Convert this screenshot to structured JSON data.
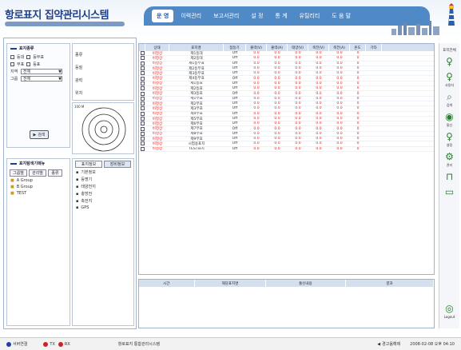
{
  "app": {
    "title": "항로표지 집약관리시스템"
  },
  "nav": {
    "tabs": [
      {
        "label": "운 영",
        "active": true
      },
      {
        "label": "이력관리",
        "active": false
      },
      {
        "label": "보고서관리",
        "active": false
      },
      {
        "label": "설 정",
        "active": false
      },
      {
        "label": "통 계",
        "active": false
      },
      {
        "label": "유틸리티",
        "active": false
      },
      {
        "label": "도 움 말",
        "active": false
      }
    ]
  },
  "left": {
    "search_header": "표지종류",
    "filter_opts": [
      "등대",
      "등부표",
      "부표",
      "등표"
    ],
    "region_label": "지역",
    "region_value": "전체",
    "group_label": "그룹",
    "group_value": "전체",
    "search_button": "검색",
    "info_labels": [
      "종류",
      "등질",
      "광력",
      "위치"
    ],
    "radar_scale": "100 M",
    "tree_header": "표지탐색기메뉴",
    "tree_tabs": [
      "그룹별",
      "관리별",
      "종류"
    ],
    "tree_items": [
      "A Group",
      "B Group",
      "TEST"
    ],
    "info_tabs": [
      "표지정보",
      "장비정보"
    ],
    "equipment_items": [
      "기본정보",
      "등명기",
      "태양전지",
      "충방전",
      "축전지",
      "GPS"
    ]
  },
  "table": {
    "columns": [
      "상태",
      "표지명",
      "점등기",
      "출력(V)",
      "출력(A)",
      "태양(V)",
      "축전(V)",
      "축전(A)",
      "온도",
      "기타"
    ],
    "rows": [
      [
        "비정상",
        "제1등대",
        "Off",
        "0.0",
        "0.0",
        "0.0",
        "0.0",
        "0.0",
        "0"
      ],
      [
        "비정상",
        "제2등대",
        "Off",
        "0.0",
        "0.0",
        "0.0",
        "0.0",
        "0.0",
        "0"
      ],
      [
        "비정상",
        "제1등부표",
        "Off",
        "0.0",
        "0.0",
        "0.0",
        "0.0",
        "0.0",
        "0"
      ],
      [
        "비정상",
        "제2등부표",
        "Off",
        "0.0",
        "0.0",
        "0.0",
        "0.0",
        "0.0",
        "0"
      ],
      [
        "비정상",
        "제3등부표",
        "Off",
        "0.0",
        "0.0",
        "0.0",
        "0.0",
        "0.0",
        "0"
      ],
      [
        "비정상",
        "제4등부표",
        "Off",
        "0.0",
        "0.0",
        "0.0",
        "0.0",
        "0.0",
        "0"
      ],
      [
        "비정상",
        "제1등표",
        "Off",
        "0.0",
        "0.0",
        "0.0",
        "0.0",
        "0.0",
        "0"
      ],
      [
        "비정상",
        "제2등표",
        "Off",
        "0.0",
        "0.0",
        "0.0",
        "0.0",
        "0.0",
        "0"
      ],
      [
        "비정상",
        "제3등표",
        "Off",
        "0.0",
        "0.0",
        "0.0",
        "0.0",
        "0.0",
        "0"
      ],
      [
        "비정상",
        "제1부표",
        "Off",
        "0.0",
        "0.0",
        "0.0",
        "0.0",
        "0.0",
        "0"
      ],
      [
        "비정상",
        "제2부표",
        "Off",
        "0.0",
        "0.0",
        "0.0",
        "0.0",
        "0.0",
        "0"
      ],
      [
        "비정상",
        "제3부표",
        "Off",
        "0.0",
        "0.0",
        "0.0",
        "0.0",
        "0.0",
        "0"
      ],
      [
        "비정상",
        "제4부표",
        "Off",
        "0.0",
        "0.0",
        "0.0",
        "0.0",
        "0.0",
        "0"
      ],
      [
        "비정상",
        "제5부표",
        "Off",
        "0.0",
        "0.0",
        "0.0",
        "0.0",
        "0.0",
        "0"
      ],
      [
        "비정상",
        "제6부표",
        "Off",
        "0.0",
        "0.0",
        "0.0",
        "0.0",
        "0.0",
        "0"
      ],
      [
        "비정상",
        "제7부표",
        "Off",
        "0.0",
        "0.0",
        "0.0",
        "0.0",
        "0.0",
        "0"
      ],
      [
        "비정상",
        "제8부표",
        "Off",
        "0.0",
        "0.0",
        "0.0",
        "0.0",
        "0.0",
        "0"
      ],
      [
        "비정상",
        "제9부표",
        "Off",
        "0.0",
        "0.0",
        "0.0",
        "0.0",
        "0.0",
        "0"
      ],
      [
        "비정상",
        "시험용표지",
        "Off",
        "0.0",
        "0.0",
        "0.0",
        "0.0",
        "0.0",
        "0"
      ],
      [
        "비정상",
        "TEST표지",
        "Off",
        "0.0",
        "0.0",
        "0.0",
        "0.0",
        "0.0",
        "0"
      ]
    ]
  },
  "events": {
    "columns": [
      "시간",
      "해당표지명",
      "통신내용",
      "결과"
    ]
  },
  "rightbar": {
    "icons": [
      {
        "name": "light-icon",
        "label": "표지전체"
      },
      {
        "name": "user-icon",
        "label": "사용자"
      },
      {
        "name": "search-user-icon",
        "label": "검색"
      },
      {
        "name": "signal-icon",
        "label": "통신"
      },
      {
        "name": "user-icon-2",
        "label": "설정"
      },
      {
        "name": "settings-icon",
        "label": "관리"
      },
      {
        "name": "lock-icon",
        "label": ""
      },
      {
        "name": "monitor-icon",
        "label": ""
      },
      {
        "name": "exit-icon",
        "label": "Logout"
      }
    ]
  },
  "status": {
    "connection": "서버연결",
    "com": "TX",
    "com2": "RX",
    "center_text": "항로표지 통합관리시스템",
    "alarm": "경고음해제",
    "datetime": "2008-02-08 오후 04:10"
  },
  "colors": {
    "accent": "#4f89c6",
    "alert": "#dd2222",
    "title": "#1d3f8a"
  }
}
